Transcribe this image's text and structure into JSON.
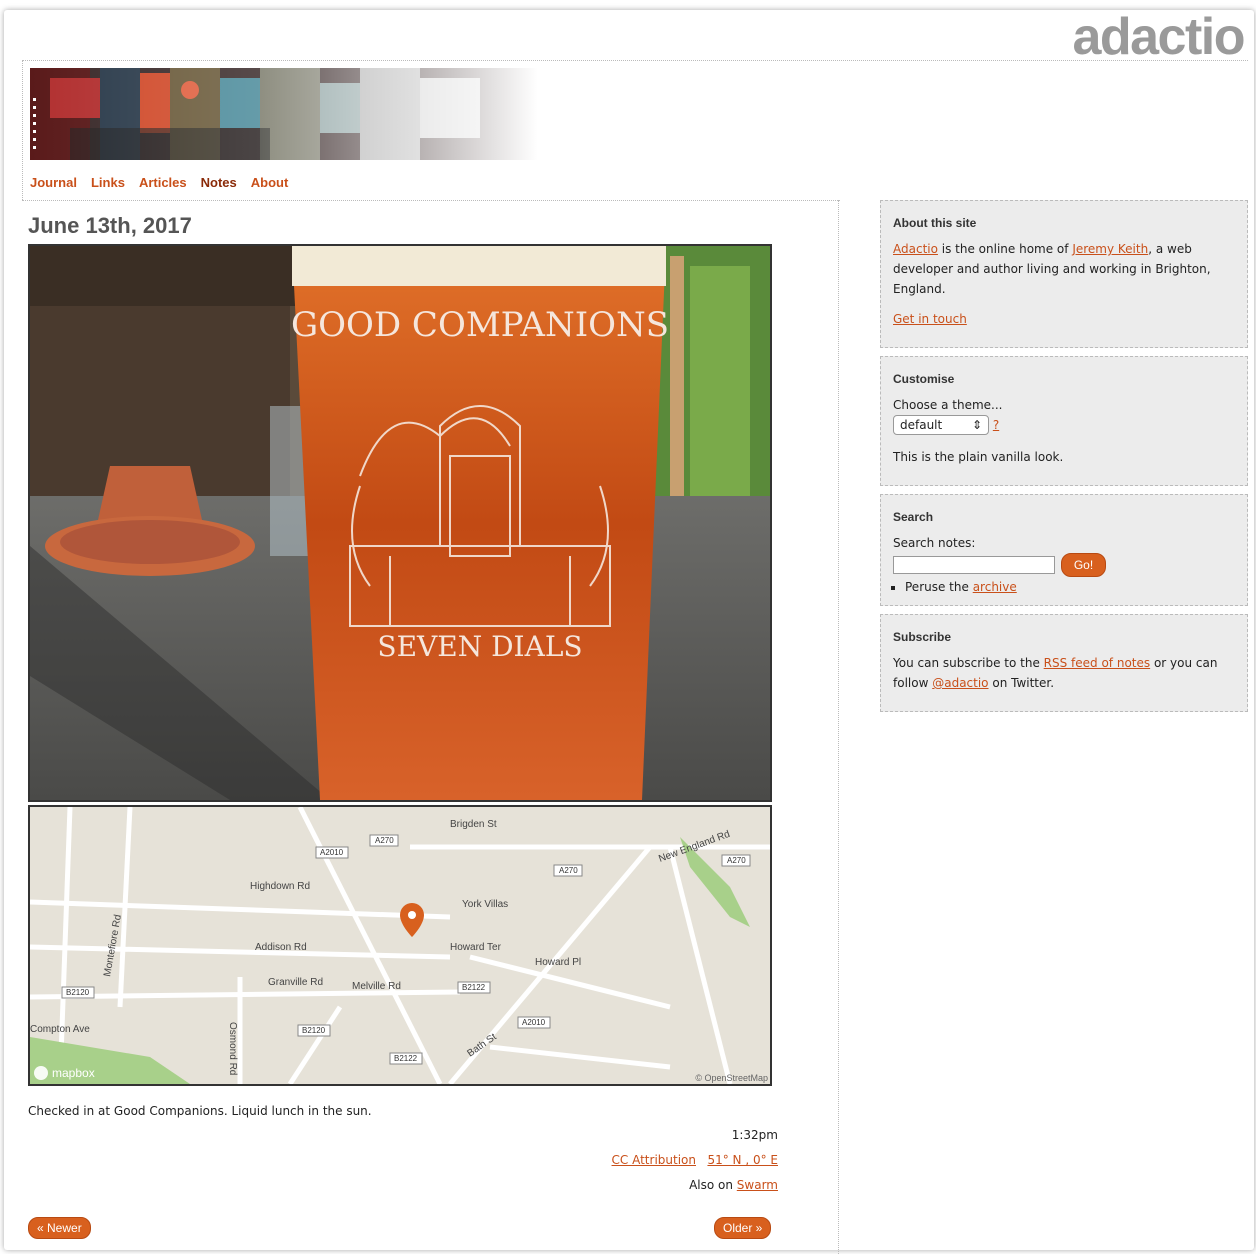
{
  "site": {
    "logo": "adactio"
  },
  "nav": [
    "Journal",
    "Links",
    "Articles",
    "Notes",
    "About"
  ],
  "post": {
    "date": "June 13th, 2017",
    "photo": {
      "glass_top_text": "GOOD COMPANIONS",
      "glass_bottom_text": "SEVEN DIALS"
    },
    "map": {
      "labels": [
        "Highdown Rd",
        "Addison Rd",
        "Granville Rd",
        "Melville Rd",
        "York Villas",
        "Howard Ter",
        "Howard Pl",
        "New England Rd",
        "Bath St",
        "Montefiore Rd",
        "Osmond Rd",
        "Compton Ave",
        "Brigden St",
        "A2010",
        "A270",
        "B2122",
        "B2120"
      ],
      "logo": "mapbox",
      "attribution": "© OpenStreetMap"
    },
    "text": "Checked in at Good Companions. Liquid lunch in the sun.",
    "time": "1:32pm",
    "licence": "CC Attribution",
    "location": "51° N , 0° E",
    "also_prefix": "Also on",
    "also_link": "Swarm"
  },
  "pagination": {
    "newer": "« Newer",
    "older": "Older »"
  },
  "sidebar": {
    "about": {
      "title": "About this site",
      "site_link": "Adactio",
      "text1": " is the online home of ",
      "person_link": "Jeremy Keith",
      "text2": ", a web developer and author living and working in Brighton, England.",
      "contact": "Get in touch"
    },
    "customise": {
      "title": "Customise",
      "prompt": "Choose a theme...",
      "selected": "default",
      "help": "?",
      "description": "This is the plain vanilla look."
    },
    "search": {
      "title": "Search",
      "label": "Search notes:",
      "button": "Go!",
      "peruse_prefix": "Peruse the",
      "archive": "archive"
    },
    "subscribe": {
      "title": "Subscribe",
      "text1": "You can subscribe to the ",
      "rss": "RSS feed of notes",
      "text2": " or you can follow ",
      "twitter": "@adactio",
      "text3": " on Twitter."
    }
  }
}
